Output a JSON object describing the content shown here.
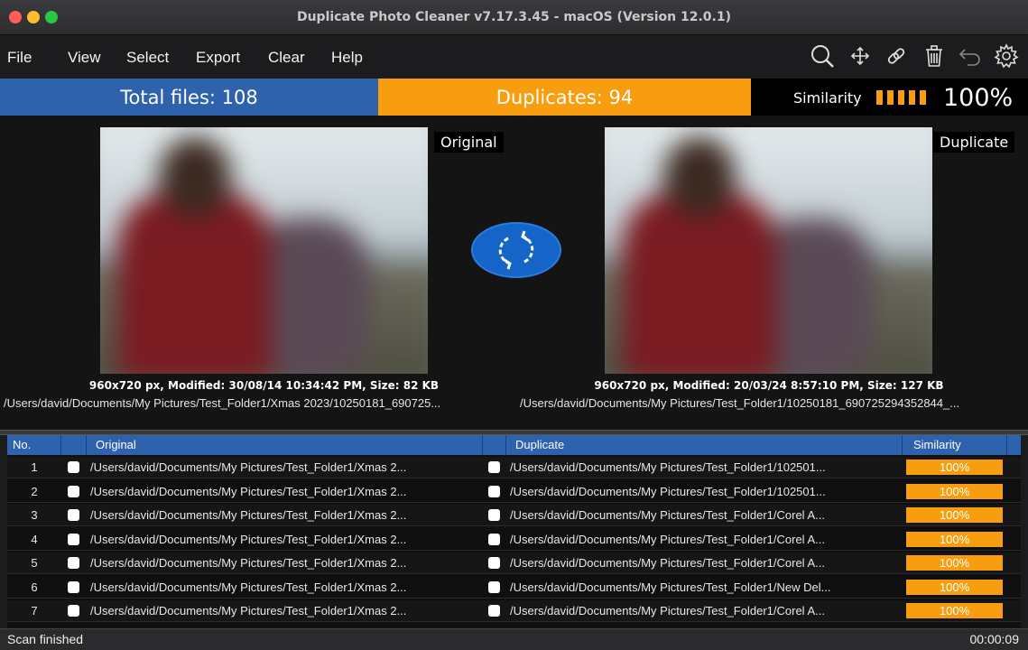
{
  "window": {
    "title": "Duplicate Photo Cleaner v7.17.3.45 - macOS (Version 12.0.1)"
  },
  "menu": [
    "File",
    "View",
    "Select",
    "Export",
    "Clear",
    "Help"
  ],
  "toolbar_icons": [
    "search-icon",
    "move-icon",
    "link-icon",
    "trash-icon",
    "undo-icon",
    "settings-icon"
  ],
  "stats": {
    "total_files": "Total files: 108",
    "duplicates": "Duplicates: 94",
    "similarity_label": "Similarity",
    "similarity_value": "100%"
  },
  "colors": {
    "blue": "#2f62ad",
    "orange": "#f89d10",
    "swap": "#1565c9"
  },
  "preview": {
    "original_tag": "Original",
    "duplicate_tag": "Duplicate",
    "original_meta": "960x720 px, Modified: 30/08/14 10:34:42 PM, Size: 82 KB",
    "duplicate_meta": "960x720 px, Modified: 20/03/24 8:57:10 PM, Size: 127 KB",
    "original_path": "/Users/david/Documents/My Pictures/Test_Folder1/Xmas 2023/10250181_690725...",
    "duplicate_path": "/Users/david/Documents/My Pictures/Test_Folder1/10250181_690725294352844_...",
    "swap_icon": "swap-icon"
  },
  "table": {
    "headers": {
      "no": "No.",
      "original": "Original",
      "duplicate": "Duplicate",
      "similarity": "Similarity"
    },
    "rows": [
      {
        "no": "1",
        "original": "/Users/david/Documents/My Pictures/Test_Folder1/Xmas 2...",
        "duplicate": "/Users/david/Documents/My Pictures/Test_Folder1/102501...",
        "similarity": "100%"
      },
      {
        "no": "2",
        "original": "/Users/david/Documents/My Pictures/Test_Folder1/Xmas 2...",
        "duplicate": "/Users/david/Documents/My Pictures/Test_Folder1/102501...",
        "similarity": "100%"
      },
      {
        "no": "3",
        "original": "/Users/david/Documents/My Pictures/Test_Folder1/Xmas 2...",
        "duplicate": "/Users/david/Documents/My Pictures/Test_Folder1/Corel A...",
        "similarity": "100%"
      },
      {
        "no": "4",
        "original": "/Users/david/Documents/My Pictures/Test_Folder1/Xmas 2...",
        "duplicate": "/Users/david/Documents/My Pictures/Test_Folder1/Corel A...",
        "similarity": "100%"
      },
      {
        "no": "5",
        "original": "/Users/david/Documents/My Pictures/Test_Folder1/Xmas 2...",
        "duplicate": "/Users/david/Documents/My Pictures/Test_Folder1/Corel A...",
        "similarity": "100%"
      },
      {
        "no": "6",
        "original": "/Users/david/Documents/My Pictures/Test_Folder1/Xmas 2...",
        "duplicate": "/Users/david/Documents/My Pictures/Test_Folder1/New Del...",
        "similarity": "100%"
      },
      {
        "no": "7",
        "original": "/Users/david/Documents/My Pictures/Test_Folder1/Xmas 2...",
        "duplicate": "/Users/david/Documents/My Pictures/Test_Folder1/Corel A...",
        "similarity": "100%"
      }
    ]
  },
  "status": {
    "message": "Scan finished",
    "time": "00:00:09"
  }
}
